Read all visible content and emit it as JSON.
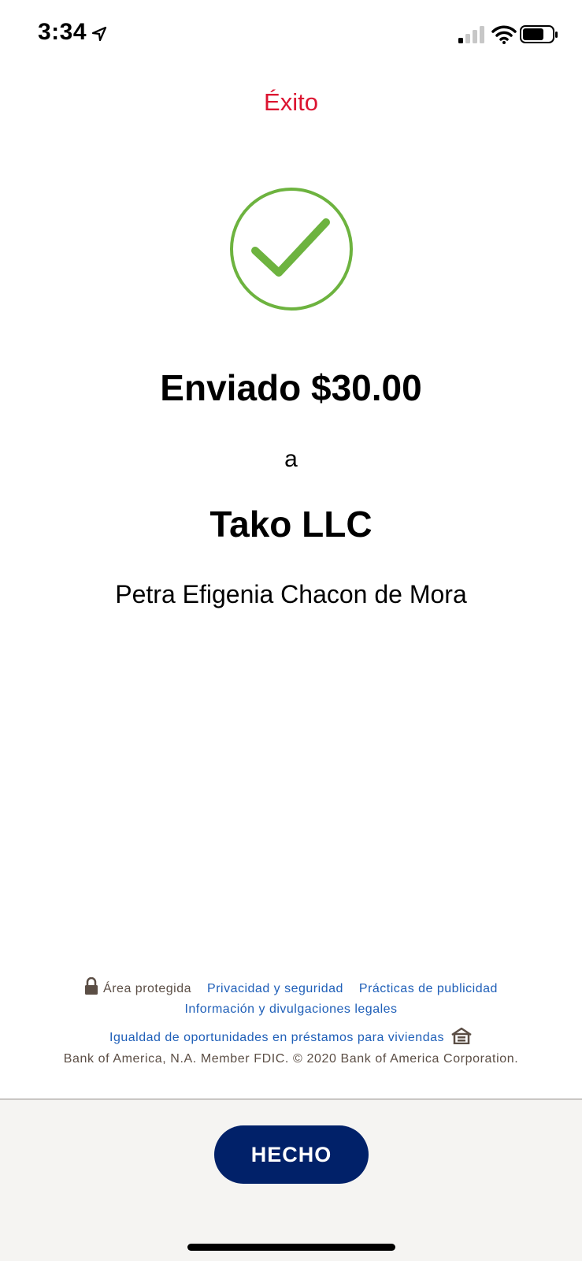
{
  "status_bar": {
    "time": "3:34",
    "icons": [
      "location-arrow-icon",
      "cellular-signal-icon",
      "wifi-icon",
      "battery-icon"
    ]
  },
  "header": {
    "title": "Éxito",
    "title_color": "#dc1431"
  },
  "confirmation": {
    "icon": "success-check-icon",
    "icon_color": "#6db33f",
    "sent_text": "Enviado $30.00",
    "to_label": "a",
    "recipient": "Tako LLC",
    "recipient_detail": "Petra Efigenia Chacon de Mora"
  },
  "footer": {
    "secure_area": "Área protegida",
    "privacy_link": "Privacidad y seguridad",
    "advertising_link": "Prácticas de publicidad",
    "legal_link": "Información y divulgaciones legales",
    "housing_link": "Igualdad de oportunidades en préstamos para viviendas",
    "copyright": "Bank of America, N.A. Member FDIC. © 2020 Bank of America Corporation.",
    "link_color": "#1f5fb8"
  },
  "actions": {
    "done_label": "HECHO",
    "button_color": "#012169"
  }
}
